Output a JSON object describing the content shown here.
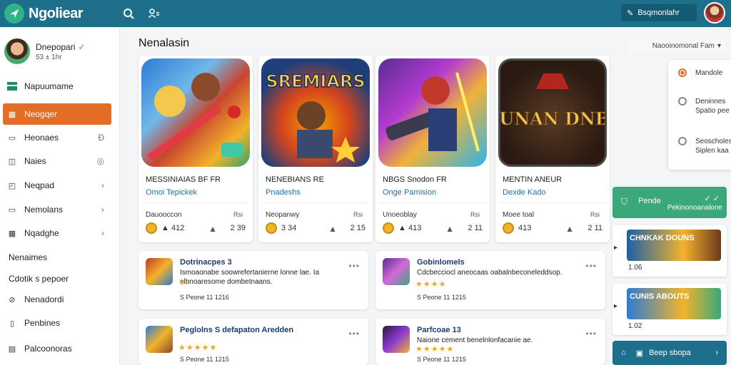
{
  "app": {
    "title": "Ngoliear",
    "accent": "#1d6f8c",
    "active_color": "#e36c27"
  },
  "topbar": {
    "icons": [
      "search-icon",
      "user-settings-icon"
    ],
    "action_label": "Bsqmonlahr",
    "action_icon": "edit-icon"
  },
  "sidebar": {
    "profile": {
      "name": "Dnepopari",
      "sub": "53 ± 1hr"
    },
    "items": [
      {
        "label": "Napuumame",
        "icon": "store-icon"
      },
      {
        "label": "Neogqer",
        "icon": "grid-icon"
      },
      {
        "label": "Heonaes",
        "icon": "window-icon"
      },
      {
        "label": "Naies",
        "icon": "layers-icon"
      },
      {
        "label": "Neqpad",
        "icon": "box-icon"
      },
      {
        "label": "Nemolans",
        "icon": "window-icon"
      },
      {
        "label": "Nqadghe",
        "icon": "grid-icon"
      },
      {
        "label": "Nenaimes"
      },
      {
        "label": "Cdotik s pepoer"
      },
      {
        "label": "Nenadordi",
        "icon": "tag-icon"
      },
      {
        "label": "Penbines",
        "icon": "page-icon"
      },
      {
        "label": "Palcoonoras",
        "icon": "calendar-icon"
      }
    ]
  },
  "main": {
    "section_title": "Nenalasin",
    "featured": [
      {
        "title": "MESSINIAIAS BF FR",
        "sub": "Omoi Tepickek",
        "dev": "Dauooccon",
        "age": "Rsi",
        "rating": "412",
        "downloads": "2 39"
      },
      {
        "title": "NENEBIANS RE",
        "sub": "Pnadeshs",
        "dev": "Neopanwy",
        "age": "Rsi",
        "rating": "3 34",
        "downloads": "2 15"
      },
      {
        "title": "NBGS Snodon FR",
        "sub": "Onge Pamision",
        "dev": "Unoeoblay",
        "age": "Rsi",
        "rating": "413",
        "downloads": "2 11"
      },
      {
        "title": "MENTIN ANEUR",
        "sub": "Dexde Kado",
        "dev": "Moee toal",
        "age": "Rsi",
        "rating": "413",
        "downloads": "2 11"
      }
    ],
    "featured_art_text": [
      "SREMIARS",
      "HAUNAN DNBAS"
    ],
    "list": [
      {
        "title": "Dotrinacpes 3",
        "desc": "Ismoaonabe soowrefertanierne lonne lae. Ia olbnoaresome dombetnaans.",
        "stars": "★",
        "meta": "S  Peone  11 1216"
      },
      {
        "title": "Gobinlomels",
        "desc": "Cdcbecciocl aneocaas oabalnbeconeleddsop.",
        "stars": "★★★★",
        "meta": "S  Peone  11 1215"
      },
      {
        "title": "Peglolns S defapaton Aredden",
        "desc": "",
        "stars": "★★★★★",
        "meta": "S  Peone  11 1215"
      },
      {
        "title": "Parfcoae 13",
        "desc": "Naione cement benelnlonfacanie ae.",
        "stars": "★★★★★",
        "meta": "S  Peone  11 1215"
      }
    ]
  },
  "right": {
    "sort_label": "Naooinomonal Fam",
    "filters": [
      {
        "label": "Mandole"
      },
      {
        "label": "Deninnes Spatio pee"
      },
      {
        "label": "Seoscholes Siplen kaa"
      }
    ],
    "promo": {
      "title": "Pende",
      "sub": "Pekinonoanalone"
    },
    "side_cards": [
      {
        "banner": "CHNKAK DOUNS",
        "num": "1.06"
      },
      {
        "banner": "CUNIS ABOUTS",
        "num": "1.02"
      }
    ],
    "bottom_button": "Beep sbopa"
  }
}
